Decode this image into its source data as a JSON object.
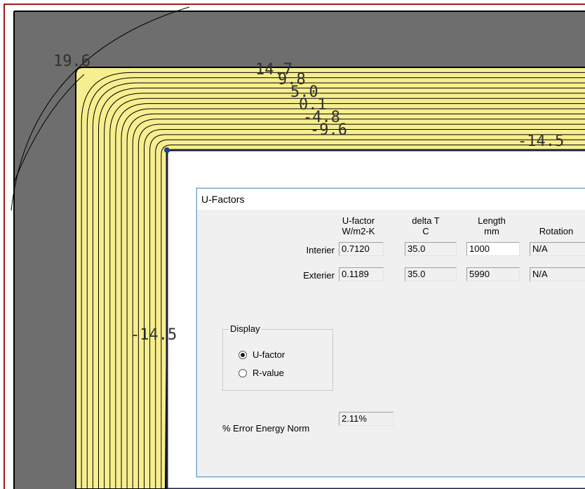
{
  "canvas": {
    "isotherm_labels": [
      "19.6",
      "14.7",
      "9.8",
      "5.0",
      "0.1",
      "-4.8",
      "-9.6",
      "-14.5",
      "-14.5"
    ],
    "colors": {
      "exterior_fill": "#6e6e6e",
      "frame_fill": "#f7ef8f",
      "line": "#000000",
      "border": "#9b1b1b"
    }
  },
  "dialog": {
    "title": "U-Factors",
    "columns": [
      {
        "line1": "U-factor",
        "line2": "W/m2-K"
      },
      {
        "line1": "delta T",
        "line2": "C"
      },
      {
        "line1": "Length",
        "line2": "mm"
      },
      {
        "line1": "",
        "line2": "Rotation"
      }
    ],
    "rows": [
      {
        "label": "Interier",
        "ufactor": "0.7120",
        "deltaT": "35.0",
        "length": "1000",
        "rotation": "N/A"
      },
      {
        "label": "Exterier",
        "ufactor": "0.1189",
        "deltaT": "35.0",
        "length": "5990",
        "rotation": "N/A"
      }
    ],
    "display": {
      "legend": "Display",
      "options": [
        {
          "label": "U-factor",
          "selected": true
        },
        {
          "label": "R-value",
          "selected": false
        }
      ]
    },
    "error_label": "% Error Energy Norm",
    "error_value": "2.11%"
  }
}
